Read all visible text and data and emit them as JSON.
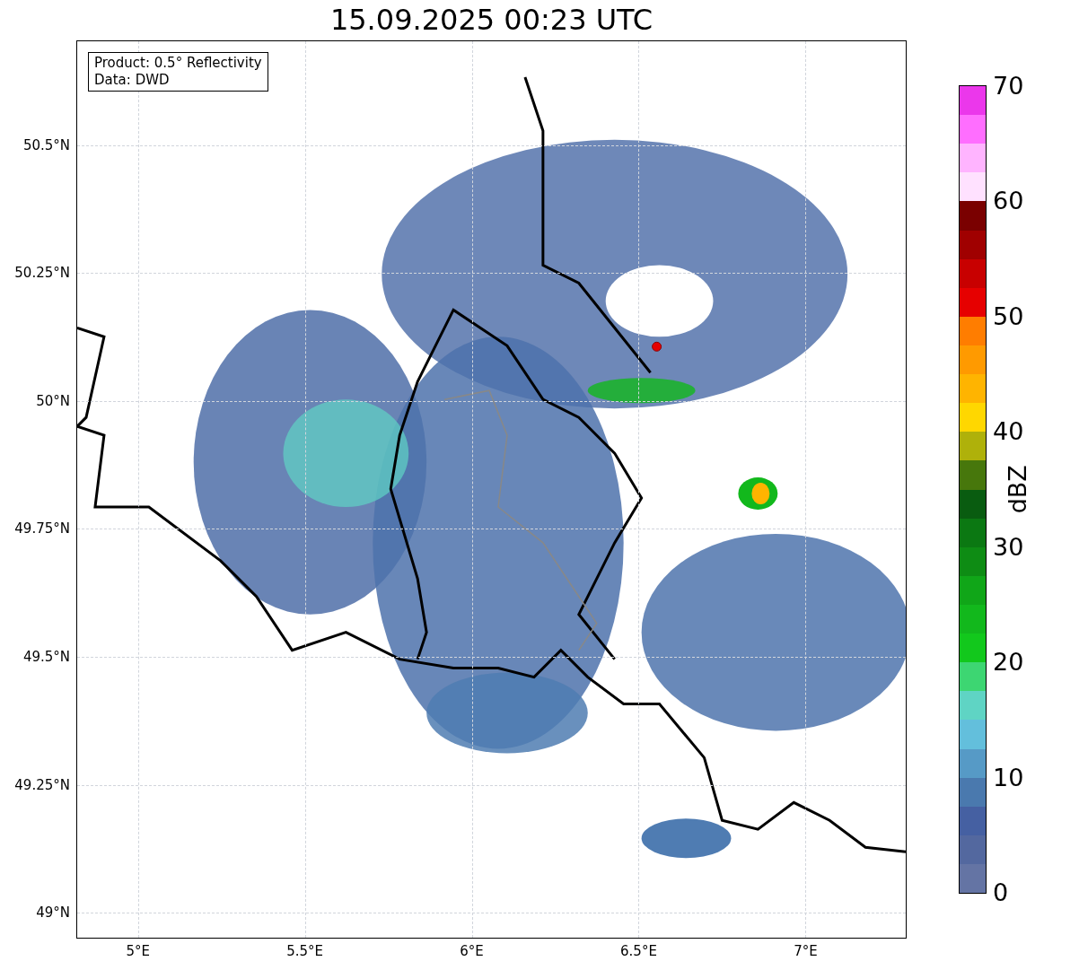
{
  "title": "15.09.2025 00:23 UTC",
  "legend": {
    "lines": [
      "Product: 0.5° Reflectivity",
      "Data: DWD"
    ]
  },
  "axes": {
    "xticks": [
      "5°E",
      "5.5°E",
      "6°E",
      "6.5°E",
      "7°E"
    ],
    "yticks": [
      "50.5°N",
      "50.25°N",
      "50°N",
      "49.75°N",
      "49.5°N",
      "49.25°N",
      "49°N"
    ]
  },
  "colorbar": {
    "label": "dBZ",
    "ticks": [
      "70",
      "60",
      "50",
      "40",
      "30",
      "20",
      "10",
      "0"
    ],
    "bins": [
      {
        "color": "#eb37eb"
      },
      {
        "color": "#ff6eff"
      },
      {
        "color": "#ffb4ff"
      },
      {
        "color": "#ffe1ff"
      },
      {
        "color": "#7a0000"
      },
      {
        "color": "#a00000"
      },
      {
        "color": "#c80000"
      },
      {
        "color": "#e60000"
      },
      {
        "color": "#ff7d00"
      },
      {
        "color": "#ff9a00"
      },
      {
        "color": "#ffb400"
      },
      {
        "color": "#ffd700"
      },
      {
        "color": "#afb10a"
      },
      {
        "color": "#47770c"
      },
      {
        "color": "#095c10"
      },
      {
        "color": "#0b7812"
      },
      {
        "color": "#0e8c14"
      },
      {
        "color": "#10a618"
      },
      {
        "color": "#12b81c"
      },
      {
        "color": "#12c81c"
      },
      {
        "color": "#3dd672"
      },
      {
        "color": "#5fd4c4"
      },
      {
        "color": "#63bfdc"
      },
      {
        "color": "#569ac6"
      },
      {
        "color": "#4a79ae"
      },
      {
        "color": "#4560a2"
      },
      {
        "color": "#53689f"
      },
      {
        "color": "#6474a4"
      }
    ]
  }
}
